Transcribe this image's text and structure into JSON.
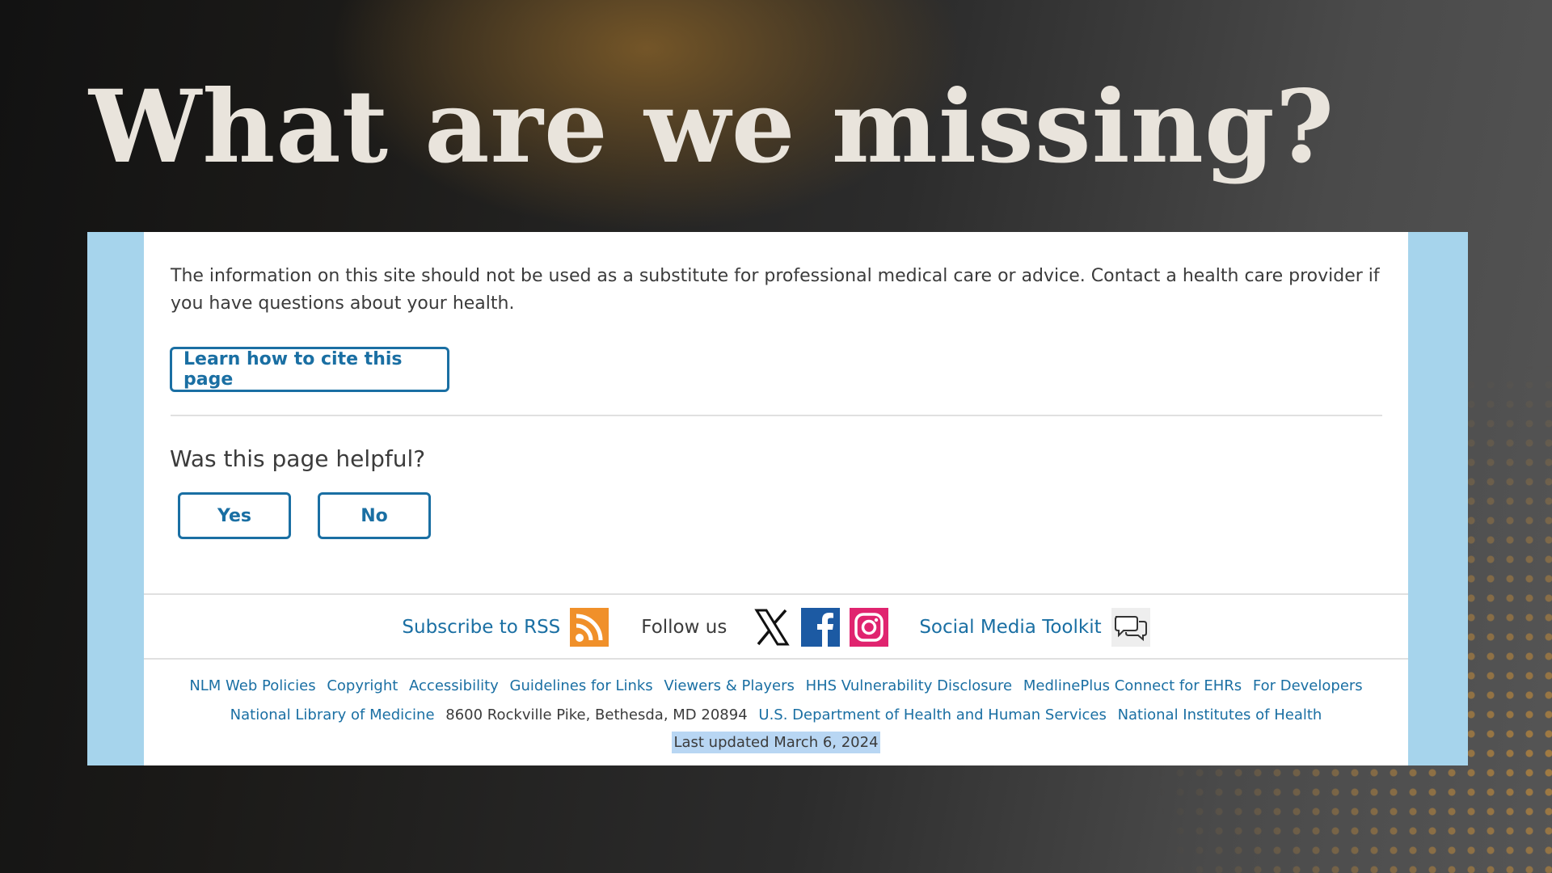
{
  "slide": {
    "title": "What are we missing?"
  },
  "page": {
    "disclaimer": "The information on this site should not be used as a substitute for professional medical care or advice. Contact a health care provider if you have questions about your health.",
    "cite_button": "Learn how to cite this page",
    "helpful_question": "Was this page helpful?",
    "yes_label": "Yes",
    "no_label": "No"
  },
  "social": {
    "subscribe_label": "Subscribe to RSS",
    "follow_label": "Follow us",
    "toolkit_label": "Social Media Toolkit",
    "icons": [
      "rss-icon",
      "x-icon",
      "facebook-icon",
      "instagram-icon",
      "speech-bubbles-icon"
    ]
  },
  "footer": {
    "row1": [
      "NLM Web Policies",
      "Copyright",
      "Accessibility",
      "Guidelines for Links",
      "Viewers & Players",
      "HHS Vulnerability Disclosure",
      "MedlinePlus Connect for EHRs",
      "For Developers"
    ],
    "row2": {
      "nlm": "National Library of Medicine",
      "address": "8600 Rockville Pike, Bethesda, MD 20894",
      "hhs": "U.S. Department of Health and Human Services",
      "nih": "National Institutes of Health"
    },
    "last_updated": "Last updated March 6, 2024"
  },
  "colors": {
    "link": "#1a6fa3",
    "rss": "#f0902a",
    "facebook": "#1c5aa3",
    "instagram": "#e0246f",
    "frame": "#a6d4ec",
    "highlight": "#b8d6f3"
  }
}
